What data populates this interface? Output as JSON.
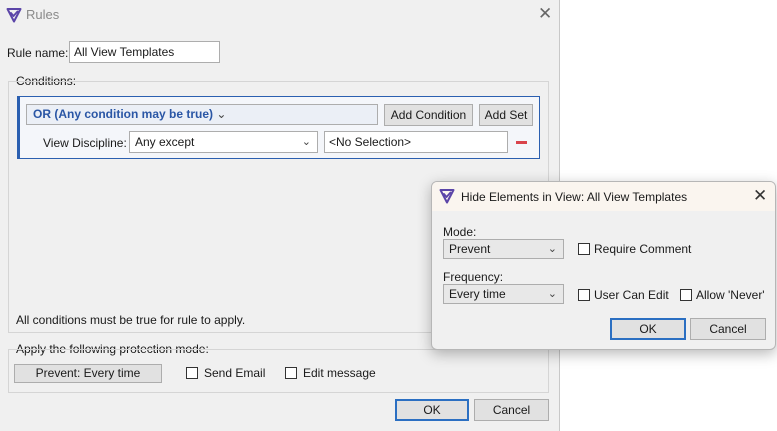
{
  "rules_window": {
    "title": "Rules",
    "rule_name_label": "Rule name:",
    "rule_name_value": "All View Templates",
    "conditions_label": "Conditions:",
    "logic_combo": "OR (Any condition may be true)",
    "add_condition_label": "Add Condition",
    "add_set_label": "Add Set",
    "condition": {
      "field_label": "View Discipline:",
      "operator": "Any except",
      "value": "<No Selection>"
    },
    "footer_note": "All conditions must be true for rule to apply.",
    "protection_label": "Apply the following protection mode:",
    "protection_button": "Prevent: Every time",
    "send_email_label": "Send Email",
    "edit_message_label": "Edit message",
    "ok_label": "OK",
    "cancel_label": "Cancel"
  },
  "hide_dialog": {
    "title": "Hide Elements in View: All View Templates",
    "mode_label": "Mode:",
    "mode_value": "Prevent",
    "require_comment_label": "Require Comment",
    "frequency_label": "Frequency:",
    "frequency_value": "Every time",
    "user_can_edit_label": "User Can Edit",
    "allow_never_label": "Allow 'Never'",
    "ok_label": "OK",
    "cancel_label": "Cancel"
  },
  "colors": {
    "accent_blue": "#2b5fb0",
    "logic_text": "#2a56a5",
    "remove_red": "#d9434b",
    "logo_purple": "#5b45a8"
  },
  "icons": {
    "app_logo": "shield-check-logo-icon",
    "close": "close-icon",
    "dropdown": "chevron-down-icon",
    "remove": "minus-icon"
  }
}
